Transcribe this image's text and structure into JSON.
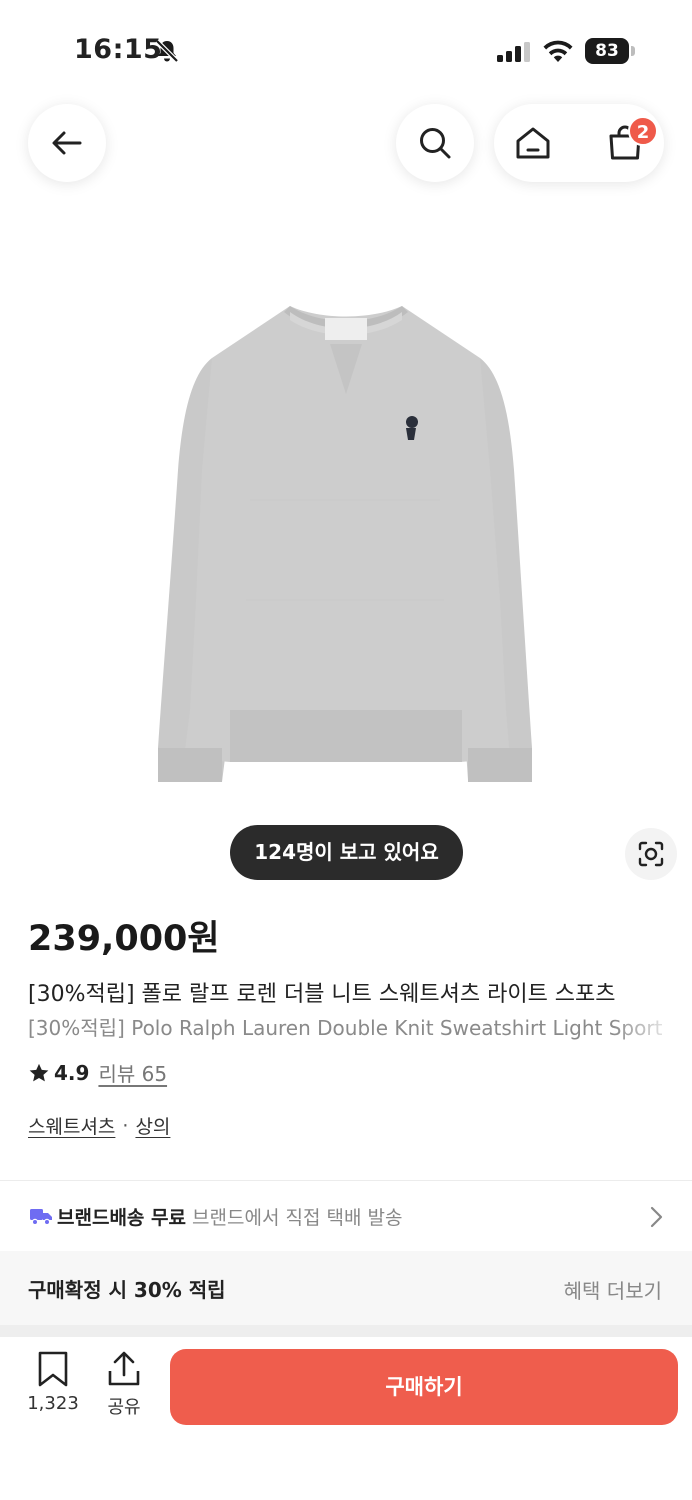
{
  "status_bar": {
    "time": "16:15",
    "battery": "83",
    "icons": [
      "bell-slash-icon",
      "cellular-signal-icon",
      "wifi-icon",
      "battery-icon"
    ]
  },
  "nav": {
    "icons": [
      "arrow-left-icon",
      "search-icon",
      "home-icon",
      "shopping-bag-icon"
    ],
    "cart_count": "2"
  },
  "product": {
    "image_icon": "gray-sweatshirt-image",
    "viewers": "124명이 보고 있어요",
    "price": "239,000원",
    "title_ko": "[30%적립] 폴로 랄프 로렌 더블 니트 스웨트셔츠 라이트 스포츠",
    "title_en": "[30%적립] Polo Ralph Lauren Double Knit Sweatshirt Light Sport",
    "rating": "4.9",
    "review_label": "리뷰 65",
    "categories": [
      "스웨트셔츠",
      "상의"
    ],
    "category_separator": "·"
  },
  "shipping": {
    "strong": "브랜드배송 무료",
    "sub": "브랜드에서 직접 택배 발송"
  },
  "benefit": {
    "title": "구매확정 시 30% 적립",
    "more": "혜택 더보기"
  },
  "bottom": {
    "bookmark_count": "1,323",
    "share_label": "공유",
    "buy_label": "구매하기"
  },
  "colors": {
    "accent": "#ef5d4d",
    "badge": "#ef5a4a",
    "truck": "#6f6cf2",
    "viewers_bg": "#2b2b2b"
  }
}
